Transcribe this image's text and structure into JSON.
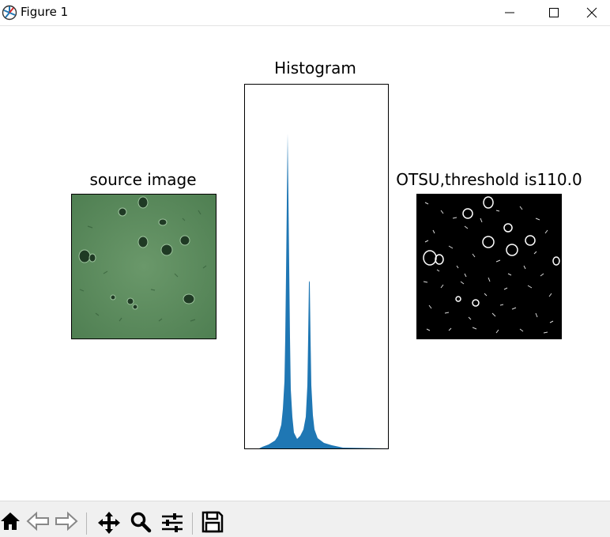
{
  "window": {
    "title": "Figure 1",
    "controls": [
      "minimize",
      "maximize",
      "close"
    ]
  },
  "figure": {
    "source_title": "source image",
    "histogram_title": "Histogram",
    "otsu_title": "OTSU,threshold is110.0"
  },
  "toolbar": {
    "buttons": [
      "home-icon",
      "back-icon",
      "forward-icon",
      "pan-icon",
      "zoom-icon",
      "configure-subplots-icon",
      "save-icon"
    ]
  },
  "colors": {
    "histogram": "#1f77b4",
    "source_bg": "#5b8a5b",
    "otsu_bg": "#000000"
  },
  "chart_data": {
    "type": "bar",
    "title": "Histogram",
    "xlabel": "",
    "ylabel": "",
    "note_axes": "no tick labels shown",
    "peaks": [
      {
        "relative_position": 0.3,
        "relative_height": 1.0
      },
      {
        "relative_position": 0.45,
        "relative_height": 0.53
      }
    ]
  }
}
